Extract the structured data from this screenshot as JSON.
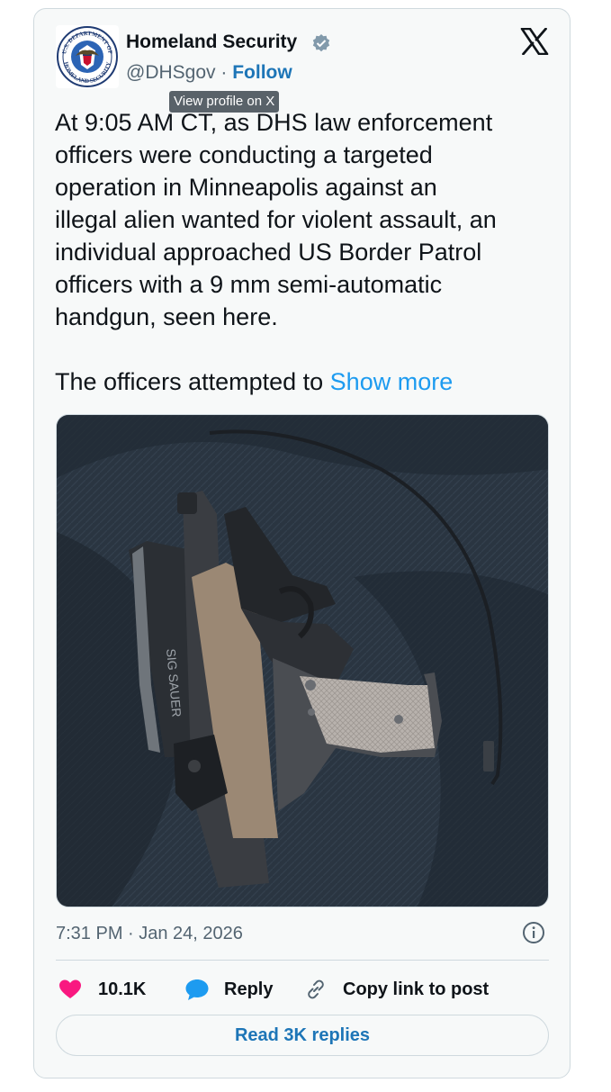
{
  "account": {
    "name": "Homeland Security",
    "handle": "@DHSgov",
    "separator": "·",
    "follow_label": "Follow",
    "seal_top_text": "U.S. DEPARTMENT OF",
    "seal_bottom_text": "HOMELAND SECURITY"
  },
  "tooltip": {
    "text": "View profile on X"
  },
  "tweet": {
    "text": "At 9:05 AM CT, as DHS law enforcement\nofficers were conducting a targeted\noperation in Minneapolis against an\nillegal alien wanted for violent assault, an\nindividual approached US Border Patrol\nofficers with a 9 mm semi-automatic\nhandgun, seen here.\n\nThe officers attempted to ",
    "show_more_label": "Show more"
  },
  "timestamp": "7:31 PM · Jan 24, 2026",
  "actions": {
    "like_count": "10.1K",
    "reply_label": "Reply",
    "copy_link_label": "Copy link to post"
  },
  "read_replies_label": "Read 3K replies",
  "colors": {
    "accent_blue": "#1d9bf0",
    "link_blue": "#1d75b7",
    "like_pink": "#f91880",
    "card_bg": "#f7f9f9",
    "border": "#cfd9de"
  },
  "icons": [
    "dhs-seal-icon",
    "verified-badge-icon",
    "x-logo-icon",
    "info-icon",
    "heart-icon",
    "reply-bubble-icon",
    "link-icon"
  ]
}
